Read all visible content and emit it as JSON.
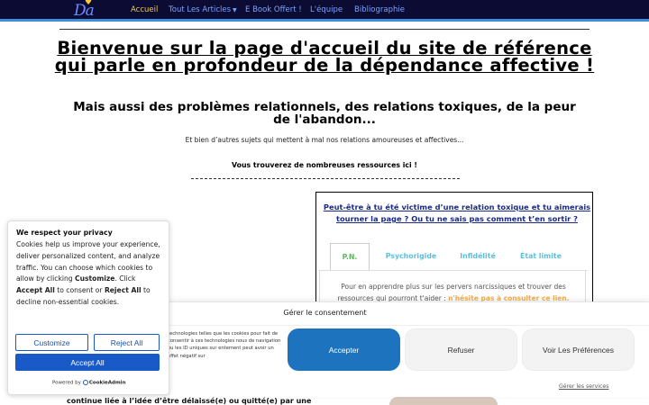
{
  "nav": {
    "logo": "Da",
    "items": [
      {
        "label": "Accueil",
        "active": true
      },
      {
        "label": "Tout Les Articles",
        "dropdown": true
      },
      {
        "label": "E Book Offert !"
      },
      {
        "label": "L'équipe"
      },
      {
        "label": "Bibliographie"
      }
    ]
  },
  "main": {
    "title": "Bienvenue sur la page d'accueil du site de référence qui parle en profondeur de la dépendance affective !",
    "subtitle": "Mais aussi des problèmes relationnels, des relations toxiques, de la peur de l'abandon...",
    "intro": "Et bien d’autres sujets qui mettent à mal nos relations amoureuses et affectives...",
    "resources": "Vous trouverez de nombreuses ressources ici !",
    "behind_text": "continue liée à l’idée d’être délaissé(e) ou quitté(e) par une"
  },
  "panel": {
    "title": "Peut-être à tu été victime d’une relation toxique et tu aimerais tourner la page ? Ou tu ne sais pas comment t’en sortir ?",
    "tabs": [
      {
        "label": "P.N.",
        "active": true
      },
      {
        "label": "Psychorigide"
      },
      {
        "label": "Infidélité"
      },
      {
        "label": "État limite"
      }
    ],
    "tab_text": "Pour en apprendre plus sur les pervers narcissiques et trouver des ressources qui pourront t'aider :",
    "tab_cta": "n'hésite pas à consulter ce lien."
  },
  "consent": {
    "title": "Gérer le consentement",
    "text": "technologies telles que les cookies pour fait de consentir à ces technologies nous de navigation ou les ID uniques sur entement peut avoir un effet négatif sur",
    "accept": "Accepter",
    "refuse": "Refuser",
    "preferences": "Voir Les Préférences",
    "manage": "Gérer les services"
  },
  "cookie": {
    "title": "We respect your privacy",
    "body_1": "Cookies help us improve your experience, deliver personalized content, and analyze traffic. You can choose which cookies to allow by clicking ",
    "customize_word": "Customize",
    "body_2": ". Click ",
    "accept_word": "Accept All",
    "body_3": " to consent or ",
    "reject_word": "Reject All",
    "body_4": " to decline non-essential cookies.",
    "customize": "Customize",
    "reject_all": "Reject All",
    "accept_all": "Accept All",
    "powered_by": "Powered by",
    "brand": "CookieAdmin"
  },
  "colors": {
    "nav_bg": "#0b0b33",
    "nav_link": "#7aa4ff",
    "nav_active": "#f2c94c",
    "accept_blue": "#1e73be",
    "cookie_blue": "#1a5ac8",
    "tab_active": "#5cb85c",
    "tab_inactive": "#5bc0de",
    "cta_orange": "#f0ad4e"
  }
}
